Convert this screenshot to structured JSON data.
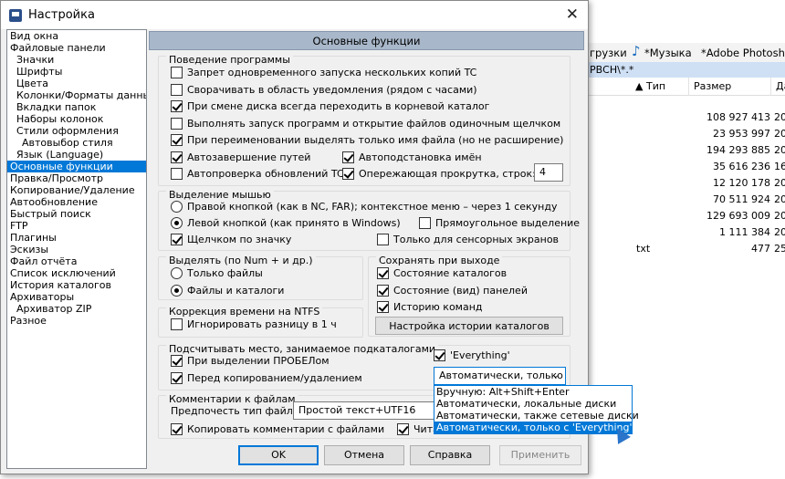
{
  "background": {
    "tabs": [
      "грузки",
      "*Музыка",
      "*Adobe Photoshop"
    ],
    "path": "РВСН\\*.*",
    "columns": [
      "Тип",
      "Размер",
      "Да"
    ],
    "rows": [
      {
        "size": "108 927 413",
        "date": "20"
      },
      {
        "size": "23 953 997",
        "date": "20"
      },
      {
        "size": "194 293 885",
        "date": "20"
      },
      {
        "size": "35 616 236",
        "date": "16"
      },
      {
        "size": "12 120 178",
        "date": "20"
      },
      {
        "size": "70 511 924",
        "date": "20"
      },
      {
        "size": "129 693 009",
        "date": "20"
      },
      {
        "size": "1 111 384",
        "date": "20"
      },
      {
        "type": "txt",
        "size": "477",
        "date": "25"
      }
    ]
  },
  "dialog": {
    "title": "Настройка",
    "close_label": "✕",
    "tree": [
      {
        "label": "Вид окна",
        "level": 0
      },
      {
        "label": "Файловые панели",
        "level": 0
      },
      {
        "label": "Значки",
        "level": 1
      },
      {
        "label": "Шрифты",
        "level": 1
      },
      {
        "label": "Цвета",
        "level": 1
      },
      {
        "label": "Колонки/Форматы данных",
        "level": 1
      },
      {
        "label": "Вкладки папок",
        "level": 1
      },
      {
        "label": "Наборы колонок",
        "level": 1
      },
      {
        "label": "Стили оформления",
        "level": 1
      },
      {
        "label": "Автовыбор стиля",
        "level": 2
      },
      {
        "label": "Язык (Language)",
        "level": 1
      },
      {
        "label": "Основные функции",
        "level": 0,
        "selected": true
      },
      {
        "label": "Правка/Просмотр",
        "level": 0
      },
      {
        "label": "Копирование/Удаление",
        "level": 0
      },
      {
        "label": "Автообновление",
        "level": 0
      },
      {
        "label": "Быстрый поиск",
        "level": 0
      },
      {
        "label": "FTP",
        "level": 0
      },
      {
        "label": "Плагины",
        "level": 0
      },
      {
        "label": "Эскизы",
        "level": 0
      },
      {
        "label": "Файл отчёта",
        "level": 0
      },
      {
        "label": "Список исключений",
        "level": 0
      },
      {
        "label": "История каталогов",
        "level": 0
      },
      {
        "label": "Архиваторы",
        "level": 0
      },
      {
        "label": "Архиватор ZIP",
        "level": 1
      },
      {
        "label": "Разное",
        "level": 0
      }
    ],
    "panel_title": "Основные функции",
    "behavior": {
      "title": "Поведение программы",
      "opt1": "Запрет одновременного запуска нескольких копий TC",
      "opt2": "Сворачивать в область уведомления (рядом с часами)",
      "opt3": "При смене диска всегда переходить в корневой каталог",
      "opt4": "Выполнять запуск программ и открытие файлов одиночным щелчком",
      "opt5": "При переименовании выделять только имя файла (но не расширение)",
      "opt6": "Автозавершение путей",
      "opt7": "Автоподстановка имён",
      "opt8": "Автопроверка обновлений TC",
      "opt9": "Опережающая прокрутка, строк:",
      "scroll_lines": "4"
    },
    "mouse": {
      "title": "Выделение мышью",
      "right": "Правой кнопкой (как в NC, FAR); контекстное меню – через 1 секунду",
      "left": "Левой кнопкой (как принято в Windows)",
      "rect": "Прямоугольное выделение",
      "icon": "Щелчком по значку",
      "touch": "Только для сенсорных экранов"
    },
    "select": {
      "title": "Выделять  (по Num + и др.)",
      "files": "Только файлы",
      "files_dirs": "Файлы и каталоги"
    },
    "save": {
      "title": "Сохранять при выходе",
      "dirs": "Состояние каталогов",
      "panels": "Состояние (вид) панелей",
      "history": "Историю команд",
      "history_btn": "Настройка истории каталогов"
    },
    "ntfs": {
      "title": "Коррекция времени на NTFS",
      "ignore": "Игнорировать разницу в 1 ч"
    },
    "space": {
      "title": "Подсчитывать место, занимаемое подкаталогами",
      "space_key": "При выделении ПРОБЕЛом",
      "before_copy": "Перед копированием/удалением",
      "everything": "'Everything'",
      "combo_value": "Автоматически, только",
      "dropdown": [
        "Вручную: Alt+Shift+Enter",
        "Автоматически, локальные диски",
        "Автоматически, также сетевые диски",
        "Автоматически, только с 'Everything'"
      ]
    },
    "comments": {
      "title": "Комментарии к файлам",
      "pref_label": "Предпочесть тип файла:",
      "pref_value": "Простой текст+UTF16",
      "copy": "Копировать комментарии с файлами",
      "read": "Чита"
    },
    "buttons": {
      "ok": "OK",
      "cancel": "Отмена",
      "help": "Справка",
      "apply": "Применить"
    }
  }
}
